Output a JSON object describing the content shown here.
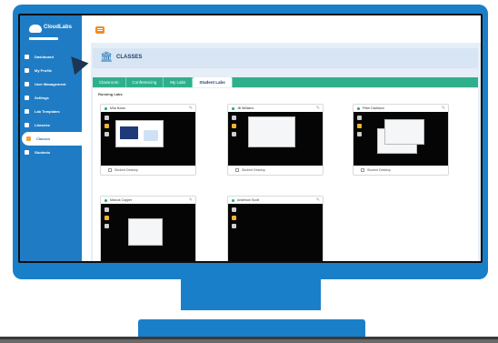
{
  "app": {
    "logo_text": "CloudLabs"
  },
  "sidebar": {
    "items": [
      {
        "label": "Dashboard",
        "icon": "monitor-icon"
      },
      {
        "label": "My Profile",
        "icon": "user-icon"
      },
      {
        "label": "User Management",
        "icon": "users-icon"
      },
      {
        "label": "Settings",
        "icon": "gear-icon"
      },
      {
        "label": "Lab Templates",
        "icon": "template-icon"
      },
      {
        "label": "Libraries",
        "icon": "library-icon"
      },
      {
        "label": "Classes",
        "icon": "classes-icon",
        "active": true
      },
      {
        "label": "Students",
        "icon": "student-icon"
      }
    ]
  },
  "page": {
    "title": "CLASSES"
  },
  "tabs": [
    "Classroom",
    "Conferencing",
    "My Labs",
    "Student Labs"
  ],
  "panel": {
    "heading": "Running Labs"
  },
  "cards": [
    {
      "name": "Mira Nolan",
      "footer": "Student Desktop"
    },
    {
      "name": "Jill Williams",
      "footer": "Student Desktop"
    },
    {
      "name": "Peter Davidson",
      "footer": "Student Desktop"
    },
    {
      "name": "Marcus Copper",
      "footer": "Student Desktop"
    },
    {
      "name": "Anderson Scott",
      "footer": "Student Desktop"
    }
  ],
  "colors": {
    "frame": "#1a7fc9",
    "sidebar": "#1f7cc4",
    "tabs": "#2fb08d",
    "accent": "#f08a24"
  }
}
